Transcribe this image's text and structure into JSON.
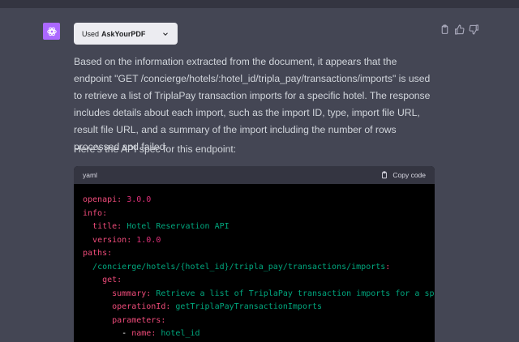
{
  "plugin": {
    "used_label": "Used",
    "name": "AskYourPDF"
  },
  "message": {
    "paragraph": "Based on the information extracted from the document, it appears that the endpoint \"GET /concierge/hotels/:hotel_id/tripla_pay/transactions/imports\" is used to retrieve a list of TriplaPay transaction imports for a specific hotel. The response includes details about each import, such as the import ID, type, import file URL, result file URL, and a summary of the import including the number of rows processed and failed.",
    "intro": "Here's the API spec for this endpoint:"
  },
  "code_block": {
    "language": "yaml",
    "copy_label": "Copy code",
    "lines": [
      {
        "key": "openapi",
        "value": "3.0.0"
      },
      {
        "key": "info",
        "value": ""
      },
      {
        "key": "title",
        "value": "Hotel Reservation API"
      },
      {
        "key": "version",
        "value": "1.0.0"
      },
      {
        "key": "paths",
        "value": ""
      },
      {
        "key": "/concierge/hotels/{hotel_id}/tripla_pay/transactions/imports",
        "value": ""
      },
      {
        "key": "get",
        "value": ""
      },
      {
        "key": "summary",
        "value": "Retrieve a list of TriplaPay transaction imports for a specif"
      },
      {
        "key": "operationId",
        "value": "getTriplaPayTransactionImports"
      },
      {
        "key": "parameters",
        "value": ""
      },
      {
        "key": "name",
        "value": "hotel_id"
      }
    ]
  }
}
